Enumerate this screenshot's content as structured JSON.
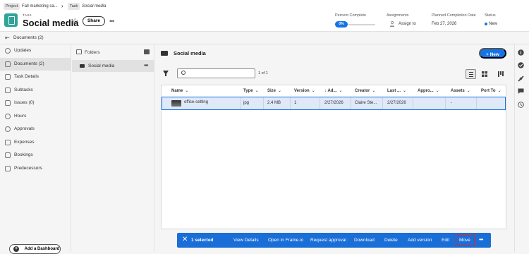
{
  "breadcrumb": {
    "project_chip": "Project",
    "project_name": "Fall marketing ca...",
    "task_chip": "Task",
    "task_name": "Social media"
  },
  "header": {
    "type_label": "TASK",
    "title": "Social media",
    "share_label": "Share",
    "percent_complete_label": "Percent Complete",
    "percent_complete_value": "0%",
    "assignments_label": "Assignments",
    "assign_to": "Assign to",
    "planned_completion_label": "Planned Completion Date",
    "planned_completion_value": "Feb 27, 2026",
    "status_label": "Status",
    "status_value": "New",
    "status_color": "#1473e6"
  },
  "docbar": {
    "label": "Documents (2)"
  },
  "nav": {
    "items": [
      {
        "label": "Updates",
        "icon": "chat-icon"
      },
      {
        "label": "Documents (2)",
        "icon": "document-icon"
      },
      {
        "label": "Task Details",
        "icon": "details-icon"
      },
      {
        "label": "Subtasks",
        "icon": "subtasks-icon"
      },
      {
        "label": "Issues (0)",
        "icon": "issues-icon"
      },
      {
        "label": "Hours",
        "icon": "clock-icon"
      },
      {
        "label": "Approvals",
        "icon": "check-circle-icon"
      },
      {
        "label": "Expenses",
        "icon": "expenses-icon"
      },
      {
        "label": "Bookings",
        "icon": "bookings-icon"
      },
      {
        "label": "Predecessors",
        "icon": "predecessors-icon"
      }
    ],
    "selected_index": 1,
    "add_dashboard": "Add a Dashboard"
  },
  "folders": {
    "header": "Folders",
    "items": [
      {
        "label": "Social media"
      }
    ]
  },
  "main": {
    "title": "Social media",
    "new_label": "New",
    "pager": "1 of 1",
    "columns": [
      "Name",
      "Type",
      "Size",
      "Version",
      "Ad...",
      "Creator",
      "Last ...",
      "Appro...",
      "Assets",
      "Port To"
    ],
    "rows": [
      {
        "name": "office-setting",
        "type": "jpg",
        "size": "2.4 MB",
        "version": "1",
        "added": "2/27/2026",
        "creator": "Claire Ste...",
        "last": "2/27/2026",
        "approval": "",
        "assets": "-",
        "sort_to": ""
      }
    ]
  },
  "action_bar": {
    "selected": "1 selected",
    "actions": [
      "View Details",
      "Open in Frame.io",
      "Request approval",
      "Download",
      "Delete",
      "Add version",
      "Edit",
      "Move"
    ],
    "highlight_color": "#e22626"
  }
}
